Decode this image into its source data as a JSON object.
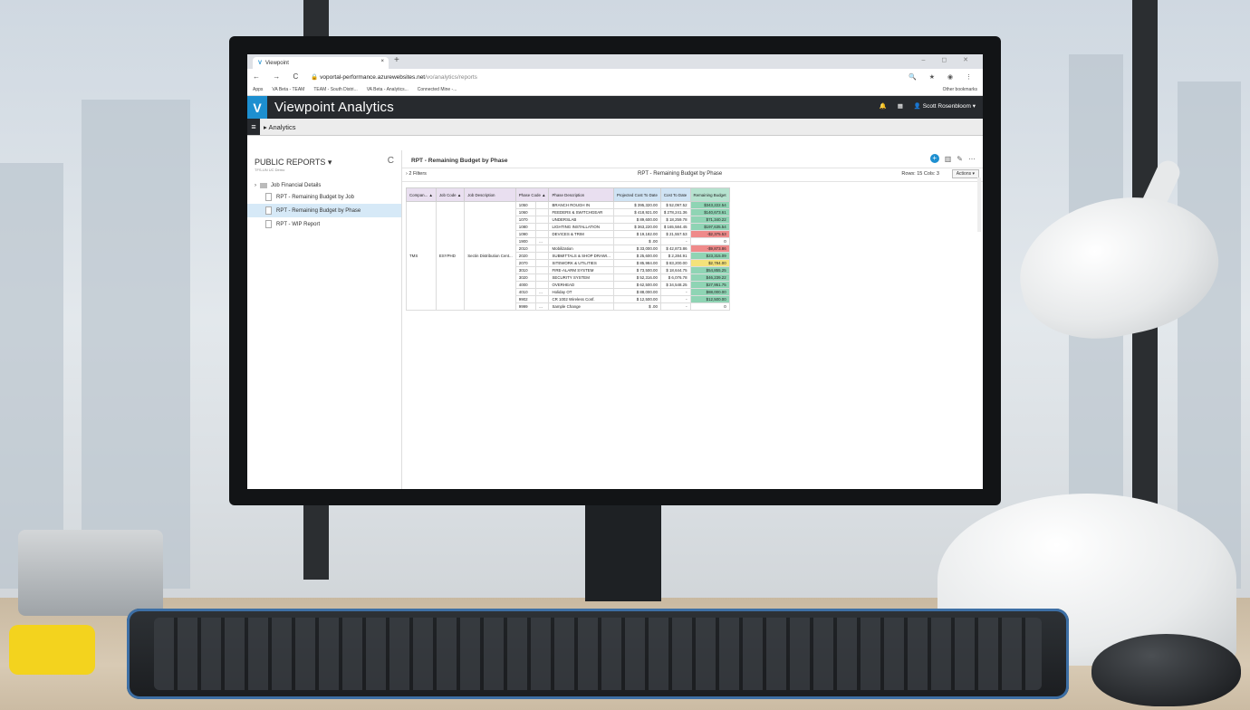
{
  "browser": {
    "tab_title": "Viewpoint",
    "tab_close": "×",
    "new_tab": "+",
    "window_controls": "– ◻ ✕",
    "nav_icons": "← → C",
    "url_host": "voportal-performance.azurewebsites.net",
    "url_path": "/vo/analytics/reports",
    "tool_icons": "🔍 ★ ◉ ⋮",
    "bookmarks": [
      "Apps",
      "VA Beta - TEAM",
      "TEAM - South Distri...",
      "VA Beta - Analytics...",
      "Connected Mine -..."
    ],
    "other_bookmarks": "Other bookmarks"
  },
  "app": {
    "logo": "V",
    "name": "Viewpoint Analytics",
    "user": "Scott Rosenbloom",
    "breadcrumb": "Analytics",
    "colors": {
      "brand": "#1d8fd0",
      "header": "#272a2e",
      "good": "#8fd4b4",
      "bad": "#ef8a8a",
      "warn": "#f4e27a"
    }
  },
  "sidebar": {
    "title": "PUBLIC REPORTS ▾",
    "subtitle": "TFS-UN UC Demo",
    "refresh": "C",
    "folder": "Job Financial Details",
    "items": [
      {
        "label": "RPT - Remaining Budget by Job"
      },
      {
        "label": "RPT - Remaining Budget by Phase"
      },
      {
        "label": "RPT - WIP Report"
      }
    ]
  },
  "report": {
    "title": "RPT - Remaining Budget by Phase",
    "filters": "› 2 Filters",
    "center_title": "RPT - Remaining Budget by Phase",
    "rows_cols": "Rows: 15  Cols: 3",
    "actions": "Actions ▾",
    "columns": [
      "Compan... ▲",
      "Job Code ▲",
      "Job Description",
      "Phase Code ▲",
      "Phase Description",
      "Projected Cost To Date",
      "Cost To Date",
      "Remaining Budget"
    ],
    "company": "TMS",
    "job_code": "ESYPHD",
    "job_description": "Sectin Distribution Cent...",
    "rows": [
      {
        "phase": "1050",
        "extra": "",
        "desc": "BRANCH ROUGH IN",
        "proj": "$ 395,320.00",
        "cost": "$ 52,097.52",
        "rem": "$343,222.54",
        "status": "good"
      },
      {
        "phase": "1060",
        "extra": "",
        "desc": "FEEDERS & SWITCHGEAR",
        "proj": "$ 418,921.00",
        "cost": "$ 278,241.36",
        "rem": "$140,673.61",
        "status": "good"
      },
      {
        "phase": "1070",
        "extra": "",
        "desc": "UNDERSLAB",
        "proj": "$ 89,600.00",
        "cost": "$ 18,259.78",
        "rem": "$71,340.22",
        "status": "good"
      },
      {
        "phase": "1080",
        "extra": "",
        "desc": "LIGHTING INSTALLATION",
        "proj": "$ 363,220.00",
        "cost": "$ 165,584.45",
        "rem": "$197,635.54",
        "status": "good"
      },
      {
        "phase": "1090",
        "extra": "",
        "desc": "DEVICES & TRIM",
        "proj": "$ 19,182.00",
        "cost": "$ 21,557.53",
        "rem": "-$2,375.53",
        "status": "bad"
      },
      {
        "phase": "1900",
        "extra": "...",
        "desc": "",
        "proj": "$ .00",
        "cost": "-",
        "rem": "0",
        "status": ""
      },
      {
        "phase": "2010",
        "extra": "",
        "desc": "Mobilization",
        "proj": "$ 33,000.00",
        "cost": "$ 42,873.86",
        "rem": "-$9,873.86",
        "status": "bad"
      },
      {
        "phase": "2020",
        "extra": "",
        "desc": "SUBMITTALS & SHOP DRAWI...",
        "proj": "$ 25,600.00",
        "cost": "$ 2,284.91",
        "rem": "$23,315.09",
        "status": "good"
      },
      {
        "phase": "2070",
        "extra": "",
        "desc": "SITEWORK & UTILITIES",
        "proj": "$ 85,984.00",
        "cost": "$ 83,200.00",
        "rem": "$2,784.00",
        "status": "warn"
      },
      {
        "phase": "3010",
        "extra": "",
        "desc": "FIRE-ALARM SYSTEM",
        "proj": "$ 73,500.00",
        "cost": "$ 18,644.75",
        "rem": "$54,855.25",
        "status": "good"
      },
      {
        "phase": "3020",
        "extra": "",
        "desc": "SECURITY SYSTEM",
        "proj": "$ 52,316.00",
        "cost": "$ 6,076.78",
        "rem": "$46,239.22",
        "status": "good"
      },
      {
        "phase": "4000",
        "extra": "",
        "desc": "OVERHEAD",
        "proj": "$ 62,500.00",
        "cost": "$ 34,548.25",
        "rem": "$27,951.75",
        "status": "good"
      },
      {
        "phase": "4010",
        "extra": "...",
        "desc": "Holiday OT",
        "proj": "$ 88,000.00",
        "cost": "-",
        "rem": "$88,000.00",
        "status": "good"
      },
      {
        "phase": "9902",
        "extra": "",
        "desc": "CR 1002 Wireless Conf.",
        "proj": "$ 12,500.00",
        "cost": "-",
        "rem": "$12,500.00",
        "status": "good"
      },
      {
        "phase": "9999",
        "extra": "...",
        "desc": "Sample Change",
        "proj": "$ .00",
        "cost": "-",
        "rem": "0",
        "status": ""
      }
    ]
  }
}
